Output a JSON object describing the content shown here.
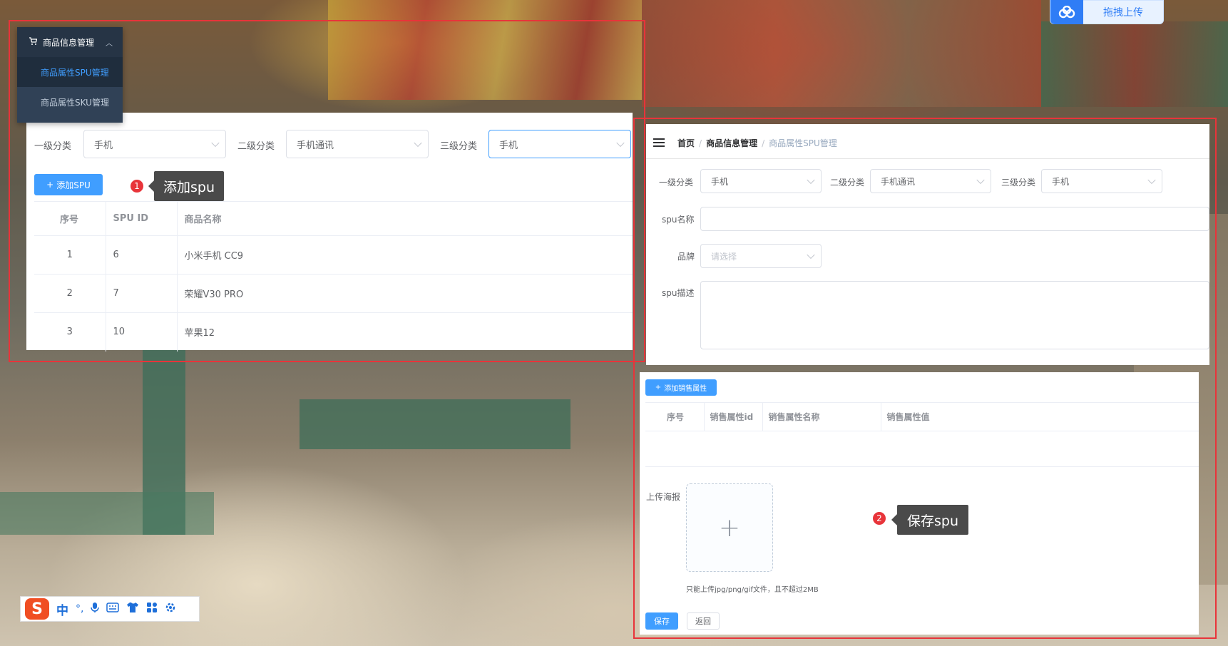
{
  "nav": {
    "group_label": "商品信息管理",
    "items": [
      {
        "label": "商品属性SPU管理",
        "active": true
      },
      {
        "label": "商品属性SKU管理",
        "active": false
      }
    ]
  },
  "left_panel": {
    "filters": [
      {
        "label": "一级分类",
        "value": "手机"
      },
      {
        "label": "二级分类",
        "value": "手机通讯"
      },
      {
        "label": "三级分类",
        "value": "手机"
      }
    ],
    "add_button": "添加SPU",
    "table": {
      "headers": [
        "序号",
        "SPU ID",
        "商品名称"
      ],
      "rows": [
        [
          "1",
          "6",
          "小米手机 CC9"
        ],
        [
          "2",
          "7",
          "荣耀V30 PRO"
        ],
        [
          "3",
          "10",
          "苹果12"
        ]
      ]
    }
  },
  "right_panel": {
    "breadcrumb": [
      "首页",
      "商品信息管理",
      "商品属性SPU管理"
    ],
    "filters": [
      {
        "label": "一级分类",
        "value": "手机"
      },
      {
        "label": "二级分类",
        "value": "手机通讯"
      },
      {
        "label": "三级分类",
        "value": "手机"
      }
    ],
    "form": {
      "spu_name_label": "spu名称",
      "spu_name_value": "",
      "brand_label": "品牌",
      "brand_placeholder": "请选择",
      "spu_desc_label": "spu描述",
      "spu_desc_value": ""
    },
    "add_attr_button": "添加销售属性",
    "attr_table": {
      "headers": [
        "序号",
        "销售属性id",
        "销售属性名称",
        "销售属性值"
      ]
    },
    "upload_label": "上传海报",
    "upload_plus": "+",
    "upload_hint": "只能上传jpg/png/gif文件，且不超过2MB",
    "save_button": "保存",
    "back_button": "返回"
  },
  "annotations": [
    {
      "number": "1",
      "text": "添加spu"
    },
    {
      "number": "2",
      "text": "保存spu"
    }
  ],
  "drag_upload": {
    "label": "拖拽上传"
  },
  "ime": {
    "logo": "S",
    "mode": "中",
    "punct": "°,"
  },
  "colors": {
    "primary": "#409eff",
    "highlight": "#e8343a",
    "nav_bg": "#304156"
  }
}
